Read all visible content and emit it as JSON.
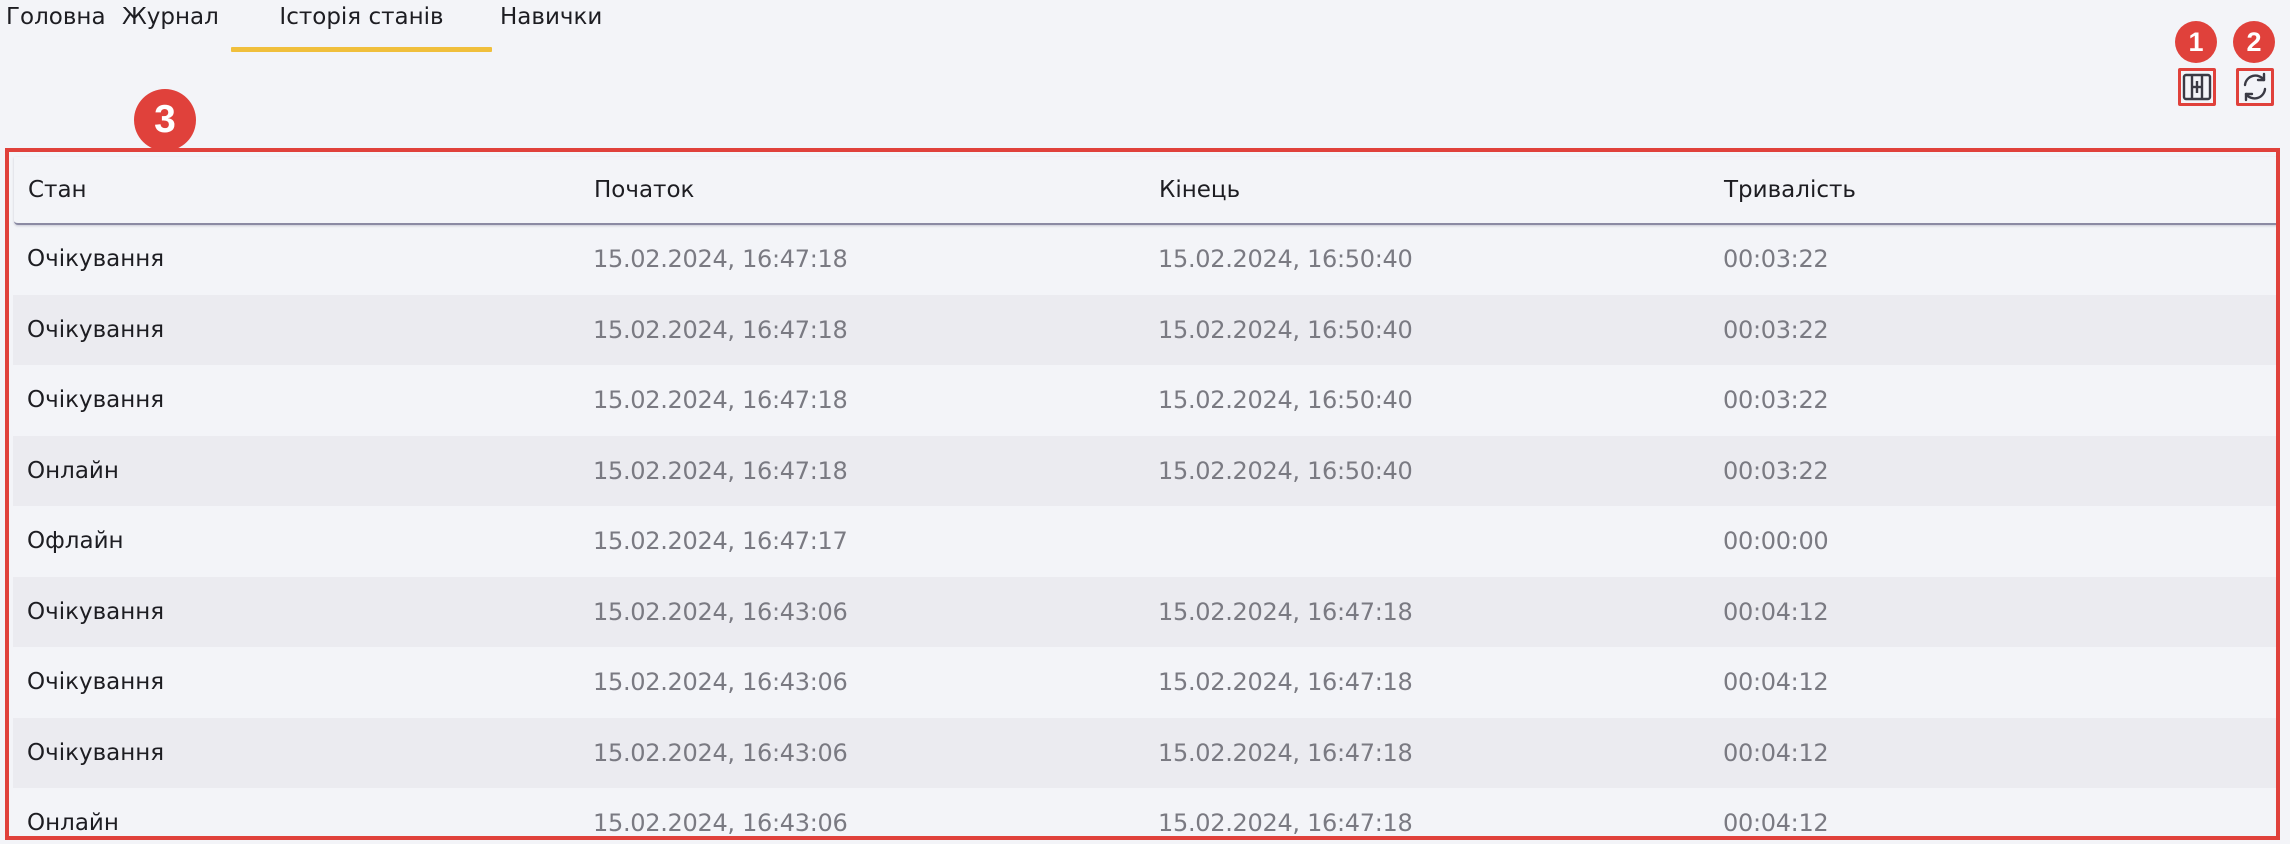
{
  "tabs": [
    {
      "label": "Головна"
    },
    {
      "label": "Журнал"
    },
    {
      "label": "Історія станів",
      "active": true
    },
    {
      "label": "Навички"
    }
  ],
  "toolbar": {
    "columns_icon": "column-settings-icon",
    "refresh_icon": "refresh-icon"
  },
  "annotations": {
    "badge_1": "1",
    "badge_2": "2",
    "badge_3": "3"
  },
  "colors": {
    "accent": "#f0bf3c",
    "highlight": "#e0413b"
  },
  "table": {
    "columns": [
      "Стан",
      "Початок",
      "Кінець",
      "Тривалість"
    ],
    "rows": [
      {
        "state": "Очікування",
        "start": "15.02.2024, 16:47:18",
        "end": "15.02.2024, 16:50:40",
        "duration": "00:03:22"
      },
      {
        "state": "Очікування",
        "start": "15.02.2024, 16:47:18",
        "end": "15.02.2024, 16:50:40",
        "duration": "00:03:22"
      },
      {
        "state": "Очікування",
        "start": "15.02.2024, 16:47:18",
        "end": "15.02.2024, 16:50:40",
        "duration": "00:03:22"
      },
      {
        "state": "Онлайн",
        "start": "15.02.2024, 16:47:18",
        "end": "15.02.2024, 16:50:40",
        "duration": "00:03:22"
      },
      {
        "state": "Офлайн",
        "start": "15.02.2024, 16:47:17",
        "end": "",
        "duration": "00:00:00"
      },
      {
        "state": "Очікування",
        "start": "15.02.2024, 16:43:06",
        "end": "15.02.2024, 16:47:18",
        "duration": "00:04:12"
      },
      {
        "state": "Очікування",
        "start": "15.02.2024, 16:43:06",
        "end": "15.02.2024, 16:47:18",
        "duration": "00:04:12"
      },
      {
        "state": "Очікування",
        "start": "15.02.2024, 16:43:06",
        "end": "15.02.2024, 16:47:18",
        "duration": "00:04:12"
      },
      {
        "state": "Онлайн",
        "start": "15.02.2024, 16:43:06",
        "end": "15.02.2024, 16:47:18",
        "duration": "00:04:12"
      }
    ]
  }
}
